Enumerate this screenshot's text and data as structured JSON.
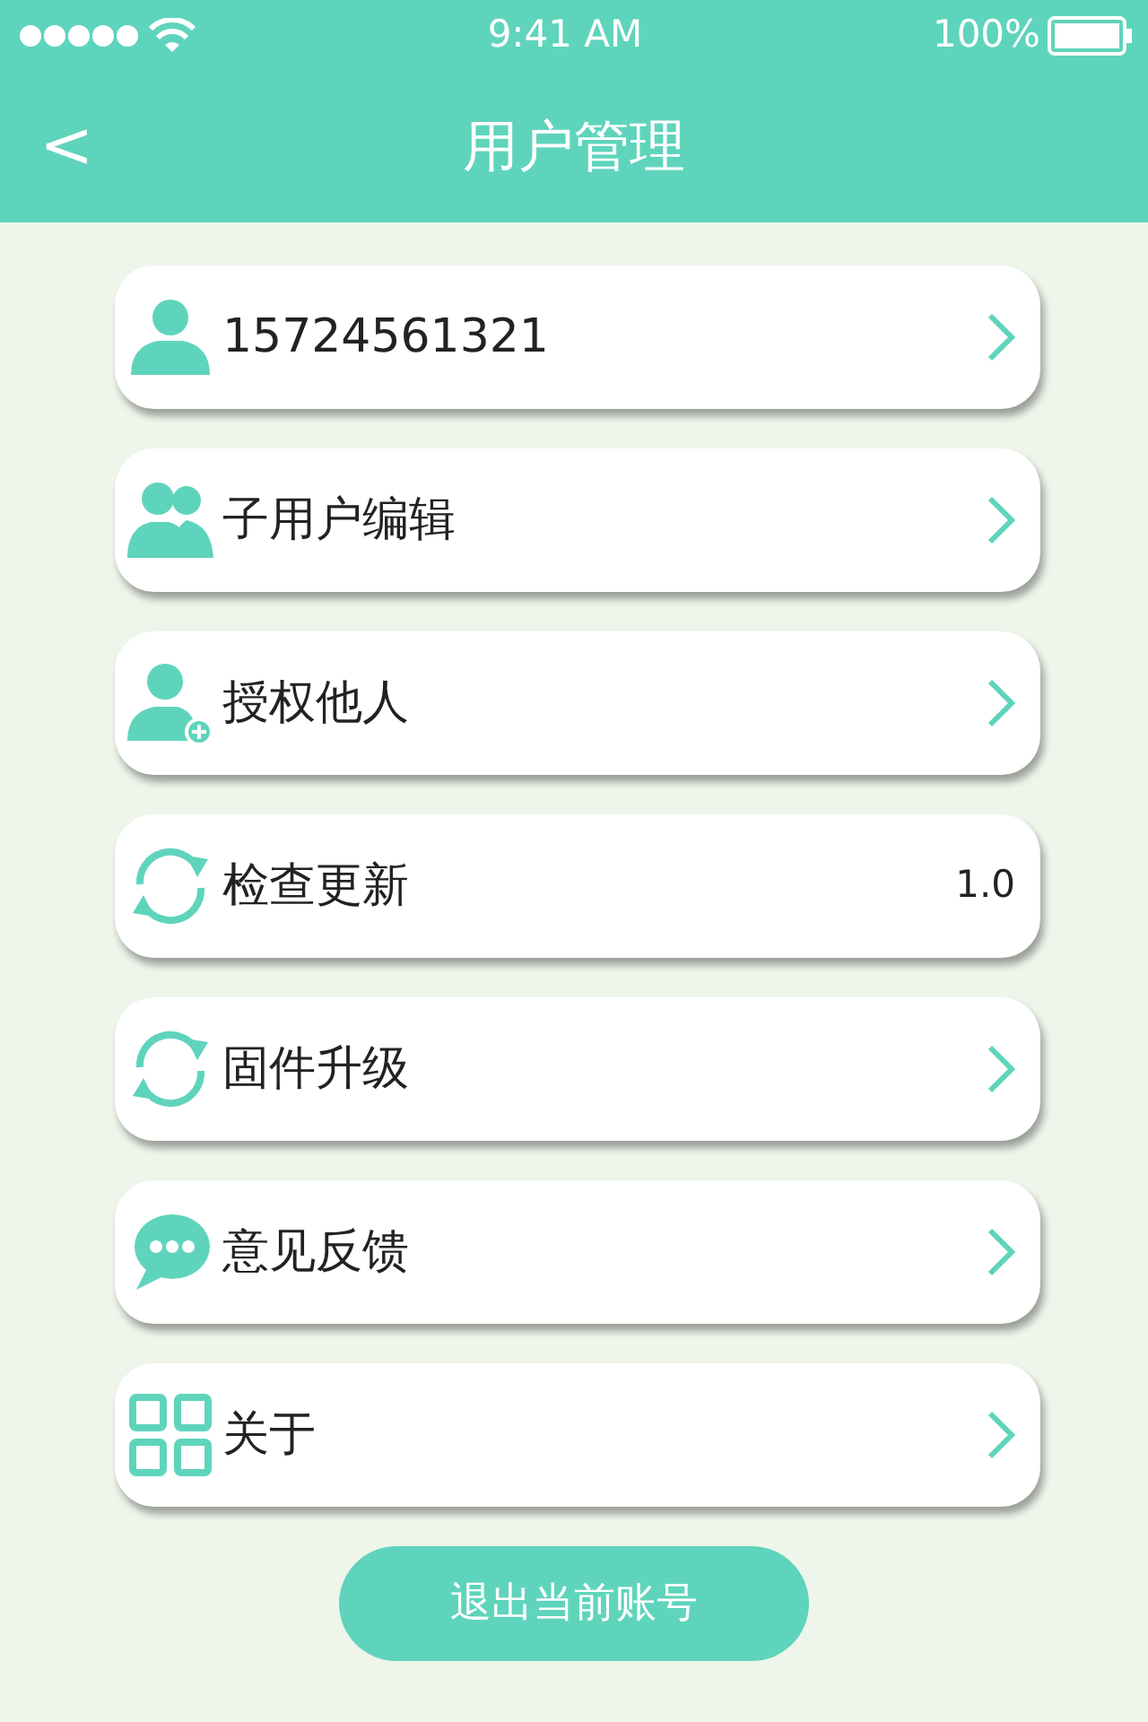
{
  "status_bar": {
    "time": "9:41 AM",
    "battery": "100%"
  },
  "header": {
    "title": "用户管理",
    "back": "<"
  },
  "items": [
    {
      "kind": "link",
      "label": "15724561321"
    },
    {
      "kind": "link",
      "label": "子用户编辑"
    },
    {
      "kind": "link",
      "label": "授权他人"
    },
    {
      "kind": "value",
      "label": "检查更新",
      "value": "1.0"
    },
    {
      "kind": "link",
      "label": "固件升级"
    },
    {
      "kind": "link",
      "label": "意见反馈"
    },
    {
      "kind": "link",
      "label": "关于"
    }
  ],
  "logout_button": "退出当前账号"
}
